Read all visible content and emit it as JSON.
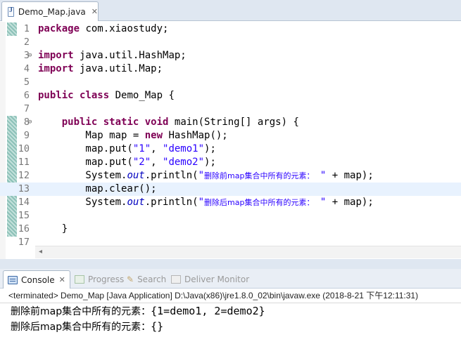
{
  "editor": {
    "tab_title": "Demo_Map.java",
    "lines": [
      {
        "n": "1",
        "tokens": [
          [
            "kw",
            "package"
          ],
          [
            "p",
            " com.xiaostudy;"
          ]
        ]
      },
      {
        "n": "2",
        "tokens": []
      },
      {
        "n": "3",
        "fold": "⊖",
        "tokens": [
          [
            "kw",
            "import"
          ],
          [
            "p",
            " java.util.HashMap;"
          ]
        ]
      },
      {
        "n": "4",
        "tokens": [
          [
            "kw",
            "import"
          ],
          [
            "p",
            " java.util.Map;"
          ]
        ]
      },
      {
        "n": "5",
        "tokens": []
      },
      {
        "n": "6",
        "tokens": [
          [
            "kw",
            "public"
          ],
          [
            "p",
            " "
          ],
          [
            "kw",
            "class"
          ],
          [
            "p",
            " Demo_Map {"
          ]
        ]
      },
      {
        "n": "7",
        "tokens": []
      },
      {
        "n": "8",
        "fold": "⊖",
        "tokens": [
          [
            "p",
            "    "
          ],
          [
            "kw",
            "public"
          ],
          [
            "p",
            " "
          ],
          [
            "kw",
            "static"
          ],
          [
            "p",
            " "
          ],
          [
            "kw",
            "void"
          ],
          [
            "p",
            " main(String[] args) {"
          ]
        ]
      },
      {
        "n": "9",
        "tokens": [
          [
            "p",
            "        Map map = "
          ],
          [
            "kw",
            "new"
          ],
          [
            "p",
            " HashMap();"
          ]
        ]
      },
      {
        "n": "10",
        "tokens": [
          [
            "p",
            "        map.put("
          ],
          [
            "str",
            "\"1\""
          ],
          [
            "p",
            ", "
          ],
          [
            "str",
            "\"demo1\""
          ],
          [
            "p",
            ");"
          ]
        ]
      },
      {
        "n": "11",
        "tokens": [
          [
            "p",
            "        map.put("
          ],
          [
            "str",
            "\"2\""
          ],
          [
            "p",
            ", "
          ],
          [
            "str",
            "\"demo2\""
          ],
          [
            "p",
            ");"
          ]
        ]
      },
      {
        "n": "12",
        "tokens": [
          [
            "p",
            "        System."
          ],
          [
            "fld",
            "out"
          ],
          [
            "p",
            ".println("
          ],
          [
            "str",
            "\""
          ],
          [
            "strcjk",
            "删除前map集合中所有的元素："
          ],
          [
            "str",
            " \""
          ],
          [
            "p",
            " + map);"
          ]
        ]
      },
      {
        "n": "13",
        "current": true,
        "tokens": [
          [
            "p",
            "        map.clear();"
          ]
        ]
      },
      {
        "n": "14",
        "tokens": [
          [
            "p",
            "        System."
          ],
          [
            "fld",
            "out"
          ],
          [
            "p",
            ".println("
          ],
          [
            "str",
            "\""
          ],
          [
            "strcjk",
            "删除后map集合中所有的元素："
          ],
          [
            "str",
            " \""
          ],
          [
            "p",
            " + map);"
          ]
        ]
      },
      {
        "n": "15",
        "tokens": []
      },
      {
        "n": "16",
        "tokens": [
          [
            "p",
            "    }"
          ]
        ]
      },
      {
        "n": "17",
        "tokens": []
      }
    ]
  },
  "console_tabs": {
    "console": "Console",
    "progress": "Progress",
    "search": "Search",
    "deliver": "Deliver Monitor"
  },
  "console": {
    "terminated": "<terminated> Demo_Map [Java Application] D:\\Java(x86)\\jre1.8.0_02\\bin\\javaw.exe (2018-8-21 下午12:11:31)",
    "output": [
      {
        "cjk": "删除前map集合中所有的元素：",
        "rest": "{1=demo1, 2=demo2}"
      },
      {
        "cjk": "删除后map集合中所有的元素：",
        "rest": "{}"
      }
    ]
  },
  "colors": {
    "keyword": "#7f0055",
    "string": "#2a00ff",
    "field": "#0000c0",
    "line_number": "#787878",
    "current_line": "#e8f2fe"
  }
}
